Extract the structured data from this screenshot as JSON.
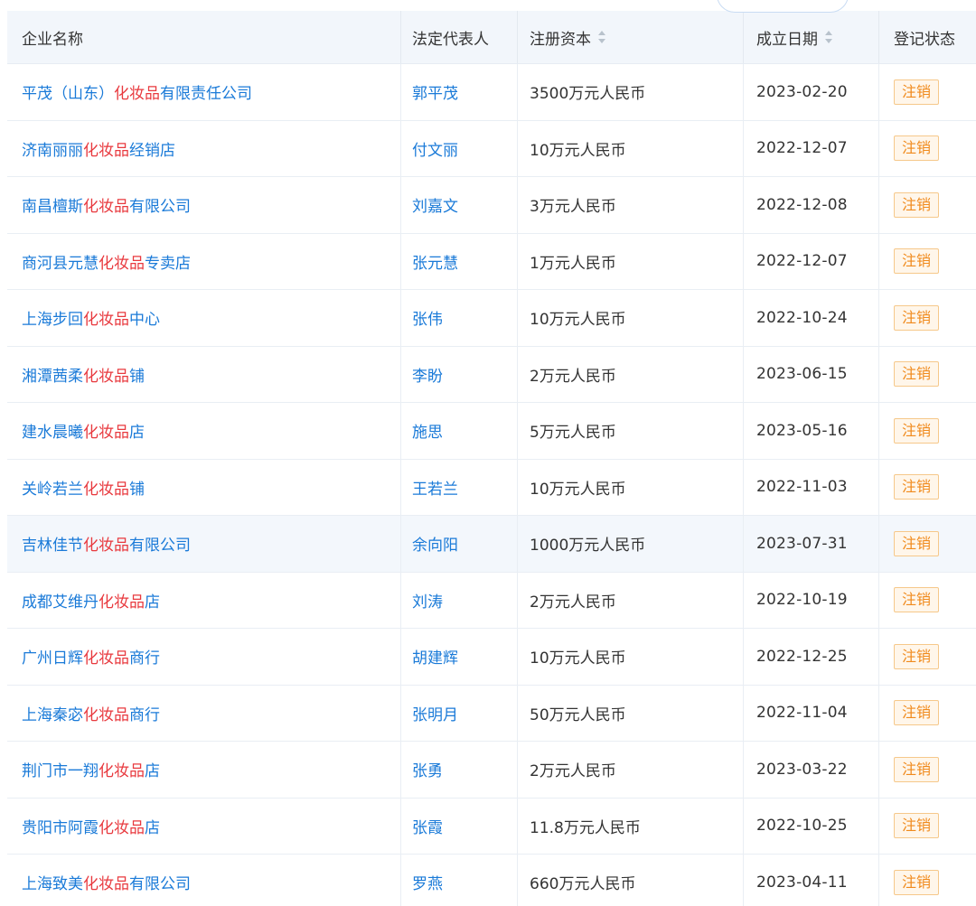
{
  "columns": {
    "name": "企业名称",
    "legal_rep": "法定代表人",
    "capital": "注册资本",
    "date": "成立日期",
    "status": "登记状态"
  },
  "rows": [
    {
      "name_pre": "平茂（山东）",
      "name_hl": "化妆品",
      "name_post": "有限责任公司",
      "legal_rep": "郭平茂",
      "capital": "3500万元人民币",
      "date": "2023-02-20",
      "status": "注销"
    },
    {
      "name_pre": "济南丽丽",
      "name_hl": "化妆品",
      "name_post": "经销店",
      "legal_rep": "付文丽",
      "capital": "10万元人民币",
      "date": "2022-12-07",
      "status": "注销"
    },
    {
      "name_pre": "南昌檀斯",
      "name_hl": "化妆品",
      "name_post": "有限公司",
      "legal_rep": "刘嘉文",
      "capital": "3万元人民币",
      "date": "2022-12-08",
      "status": "注销"
    },
    {
      "name_pre": "商河县元慧",
      "name_hl": "化妆品",
      "name_post": "专卖店",
      "legal_rep": "张元慧",
      "capital": "1万元人民币",
      "date": "2022-12-07",
      "status": "注销"
    },
    {
      "name_pre": "上海步回",
      "name_hl": "化妆品",
      "name_post": "中心",
      "legal_rep": "张伟",
      "capital": "10万元人民币",
      "date": "2022-10-24",
      "status": "注销"
    },
    {
      "name_pre": "湘潭茜柔",
      "name_hl": "化妆品",
      "name_post": "铺",
      "legal_rep": "李盼",
      "capital": "2万元人民币",
      "date": "2023-06-15",
      "status": "注销"
    },
    {
      "name_pre": "建水晨曦",
      "name_hl": "化妆品",
      "name_post": "店",
      "legal_rep": "施思",
      "capital": "5万元人民币",
      "date": "2023-05-16",
      "status": "注销"
    },
    {
      "name_pre": "关岭若兰",
      "name_hl": "化妆品",
      "name_post": "铺",
      "legal_rep": "王若兰",
      "capital": "10万元人民币",
      "date": "2022-11-03",
      "status": "注销"
    },
    {
      "name_pre": "吉林佳节",
      "name_hl": "化妆品",
      "name_post": "有限公司",
      "legal_rep": "余向阳",
      "capital": "1000万元人民币",
      "date": "2023-07-31",
      "status": "注销"
    },
    {
      "name_pre": "成都艾维丹",
      "name_hl": "化妆品",
      "name_post": "店",
      "legal_rep": "刘涛",
      "capital": "2万元人民币",
      "date": "2022-10-19",
      "status": "注销"
    },
    {
      "name_pre": "广州日辉",
      "name_hl": "化妆品",
      "name_post": "商行",
      "legal_rep": "胡建辉",
      "capital": "10万元人民币",
      "date": "2022-12-25",
      "status": "注销"
    },
    {
      "name_pre": "上海秦宓",
      "name_hl": "化妆品",
      "name_post": "商行",
      "legal_rep": "张明月",
      "capital": "50万元人民币",
      "date": "2022-11-04",
      "status": "注销"
    },
    {
      "name_pre": "荆门市一翔",
      "name_hl": "化妆品",
      "name_post": "店",
      "legal_rep": "张勇",
      "capital": "2万元人民币",
      "date": "2023-03-22",
      "status": "注销"
    },
    {
      "name_pre": "贵阳市阿霞",
      "name_hl": "化妆品",
      "name_post": "店",
      "legal_rep": "张霞",
      "capital": "11.8万元人民币",
      "date": "2022-10-25",
      "status": "注销"
    },
    {
      "name_pre": "上海致美",
      "name_hl": "化妆品",
      "name_post": "有限公司",
      "legal_rep": "罗燕",
      "capital": "660万元人民币",
      "date": "2023-04-11",
      "status": "注销"
    }
  ],
  "colors": {
    "link": "#1a7ad8",
    "highlight": "#e8393e",
    "badge_text": "#f08a1c",
    "header_bg": "#f2f6fb"
  }
}
